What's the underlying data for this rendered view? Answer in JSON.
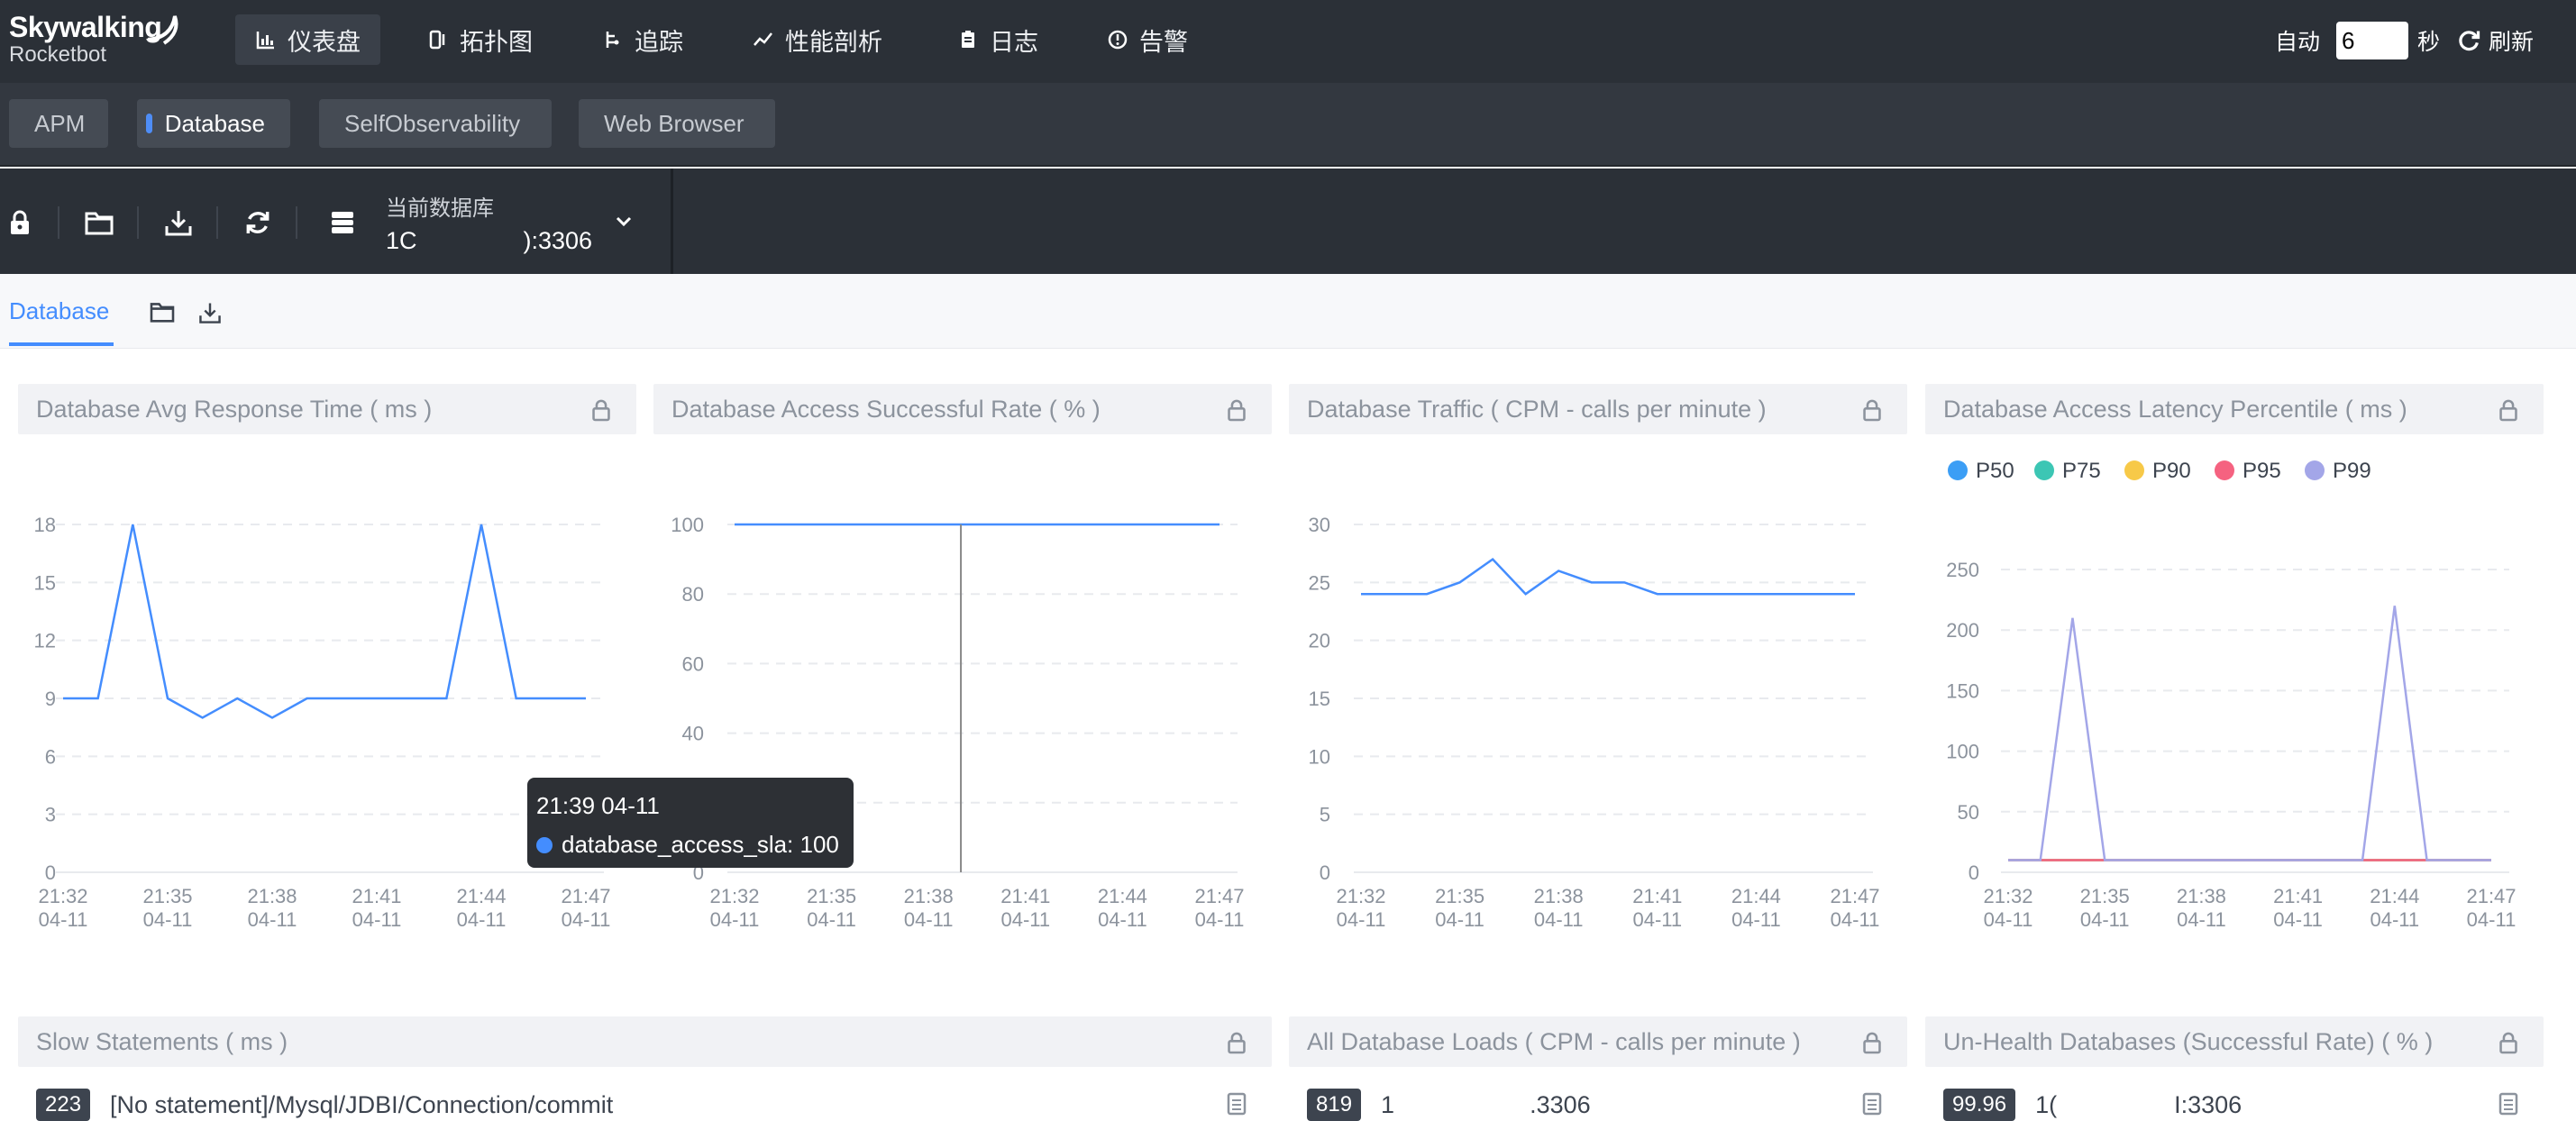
{
  "brand": {
    "name": "Skywalking",
    "product": "Rocketbot"
  },
  "nav": [
    {
      "label": "仪表盘",
      "icon": "bar-chart-icon"
    },
    {
      "label": "拓扑图",
      "icon": "topology-icon"
    },
    {
      "label": "追踪",
      "icon": "trace-icon"
    },
    {
      "label": "性能剖析",
      "icon": "line-chart-icon"
    },
    {
      "label": "日志",
      "icon": "log-icon"
    },
    {
      "label": "告警",
      "icon": "alarm-icon"
    }
  ],
  "refresh": {
    "auto_label": "自动",
    "interval": "6",
    "unit": "秒",
    "refresh_label": "刷新"
  },
  "templates": [
    "APM",
    "Database",
    "SelfObservability",
    "Web Browser"
  ],
  "toolbar": {
    "db_label": "当前数据库",
    "db_value_start": "1C",
    "db_value_end": "):3306"
  },
  "dashboard_tab": "Database",
  "panels": {
    "avg_response": "Database Avg Response Time ( ms )",
    "success_rate": "Database Access Successful Rate ( % )",
    "traffic": "Database Traffic ( CPM - calls per minute )",
    "latency": "Database Access Latency Percentile ( ms )",
    "slow": "Slow Statements ( ms )",
    "loads": "All Database Loads ( CPM - calls per minute )",
    "unhealth": "Un-Health Databases (Successful Rate) ( % )"
  },
  "tooltip": {
    "time": "21:39 04-11",
    "series": "database_access_sla: 100"
  },
  "lists": {
    "slow": {
      "badge": "223",
      "text": "[No statement]/Mysql/JDBI/Connection/commit"
    },
    "loads": {
      "badge": "819",
      "text_start": "1",
      "text_end": ".3306"
    },
    "unhealth": {
      "badge": "99.96",
      "text_start": "1(",
      "text_end": "I:3306"
    }
  },
  "colors": {
    "accent": "#448dfe",
    "p50": "#3c9ef5",
    "p75": "#3cc6b4",
    "p90": "#f7c948",
    "p95": "#f56280",
    "p99": "#a3a6e8"
  },
  "chart_data": [
    {
      "type": "line",
      "title": "Database Avg Response Time ( ms )",
      "x": [
        "21:32 04-11",
        "21:33 04-11",
        "21:34 04-11",
        "21:35 04-11",
        "21:36 04-11",
        "21:37 04-11",
        "21:38 04-11",
        "21:39 04-11",
        "21:40 04-11",
        "21:41 04-11",
        "21:42 04-11",
        "21:43 04-11",
        "21:44 04-11",
        "21:45 04-11",
        "21:46 04-11",
        "21:47 04-11"
      ],
      "xticks": [
        "21:32\n04-11",
        "21:35\n04-11",
        "21:38\n04-11",
        "21:41\n04-11",
        "21:44\n04-11",
        "21:47\n04-11"
      ],
      "series": [
        {
          "values": [
            9,
            9,
            18,
            9,
            8,
            9,
            8,
            9,
            9,
            9,
            9,
            9,
            18,
            9,
            9,
            9
          ]
        }
      ],
      "ylim": [
        0,
        18
      ],
      "yticks": [
        0,
        3,
        6,
        9,
        12,
        15,
        18
      ]
    },
    {
      "type": "line",
      "title": "Database Access Successful Rate ( % )",
      "x": [
        "21:32",
        "21:33",
        "21:34",
        "21:35",
        "21:36",
        "21:37",
        "21:38",
        "21:39",
        "21:40",
        "21:41",
        "21:42",
        "21:43",
        "21:44",
        "21:45",
        "21:46",
        "21:47"
      ],
      "series": [
        {
          "name": "database_access_sla",
          "values": [
            100,
            100,
            100,
            100,
            100,
            100,
            100,
            100,
            100,
            100,
            100,
            100,
            100,
            100,
            100,
            100
          ]
        }
      ],
      "ylim": [
        0,
        100
      ],
      "yticks": [
        0,
        20,
        40,
        60,
        80,
        100
      ]
    },
    {
      "type": "line",
      "title": "Database Traffic ( CPM - calls per minute )",
      "x": [
        "21:32",
        "21:33",
        "21:34",
        "21:35",
        "21:36",
        "21:37",
        "21:38",
        "21:39",
        "21:40",
        "21:41",
        "21:42",
        "21:43",
        "21:44",
        "21:45",
        "21:46",
        "21:47"
      ],
      "series": [
        {
          "values": [
            24,
            24,
            24,
            25,
            27,
            24,
            26,
            25,
            25,
            24,
            24,
            24,
            24,
            24,
            24,
            24
          ]
        }
      ],
      "ylim": [
        0,
        30
      ],
      "yticks": [
        0,
        5,
        10,
        15,
        20,
        25,
        30
      ]
    },
    {
      "type": "line",
      "title": "Database Access Latency Percentile ( ms )",
      "legend": "top-left",
      "x": [
        "21:32",
        "21:33",
        "21:34",
        "21:35",
        "21:36",
        "21:37",
        "21:38",
        "21:39",
        "21:40",
        "21:41",
        "21:42",
        "21:43",
        "21:44",
        "21:45",
        "21:46",
        "21:47"
      ],
      "series": [
        {
          "name": "P50",
          "values": [
            10,
            10,
            10,
            10,
            10,
            10,
            10,
            10,
            10,
            10,
            10,
            10,
            10,
            10,
            10,
            10
          ]
        },
        {
          "name": "P75",
          "values": [
            10,
            10,
            10,
            10,
            10,
            10,
            10,
            10,
            10,
            10,
            10,
            10,
            10,
            10,
            10,
            10
          ]
        },
        {
          "name": "P90",
          "values": [
            10,
            10,
            10,
            10,
            10,
            10,
            10,
            10,
            10,
            10,
            10,
            10,
            10,
            10,
            10,
            10
          ]
        },
        {
          "name": "P95",
          "values": [
            10,
            10,
            10,
            10,
            10,
            10,
            10,
            10,
            10,
            10,
            10,
            10,
            10,
            10,
            10,
            10
          ]
        },
        {
          "name": "P99",
          "values": [
            10,
            10,
            210,
            10,
            10,
            10,
            10,
            10,
            10,
            10,
            10,
            10,
            220,
            10,
            10,
            10
          ]
        }
      ],
      "ylim": [
        0,
        250
      ],
      "yticks": [
        0,
        50,
        100,
        150,
        200,
        250
      ]
    }
  ]
}
